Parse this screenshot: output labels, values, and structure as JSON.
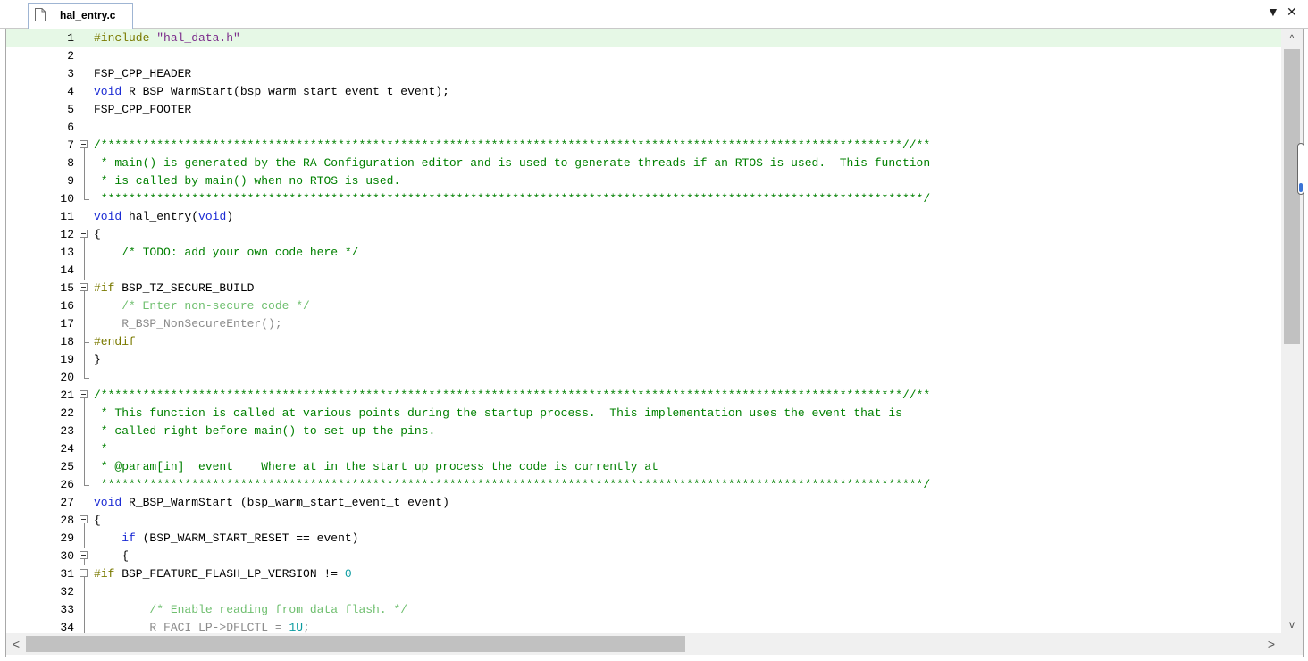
{
  "tab": {
    "filename": "hal_entry.c",
    "dropdown_icon": "▼",
    "close_icon": "✕"
  },
  "colors": {
    "keyword": "#1b2bd4",
    "comment": "#008000",
    "preprocessor": "#7a7a00",
    "string": "#7b2b8b",
    "number": "#0a9ba0",
    "inactive": "#8a8a8a",
    "inactive_comment": "#6fbf6f",
    "plain": "#000000",
    "current_line": "#e6f8e6"
  },
  "lines": [
    {
      "n": "1",
      "fold": "none",
      "hl": true,
      "tokens": [
        {
          "t": "#include ",
          "c": "preprocessor"
        },
        {
          "t": "\"hal_data.h\"",
          "c": "string"
        }
      ]
    },
    {
      "n": "2",
      "fold": "none",
      "tokens": []
    },
    {
      "n": "3",
      "fold": "none",
      "tokens": [
        {
          "t": "FSP_CPP_HEADER",
          "c": "plain"
        }
      ]
    },
    {
      "n": "4",
      "fold": "none",
      "tokens": [
        {
          "t": "void",
          "c": "keyword"
        },
        {
          "t": " R_BSP_WarmStart(bsp_warm_start_event_t event);",
          "c": "plain"
        }
      ]
    },
    {
      "n": "5",
      "fold": "none",
      "tokens": [
        {
          "t": "FSP_CPP_FOOTER",
          "c": "plain"
        }
      ]
    },
    {
      "n": "6",
      "fold": "none",
      "tokens": []
    },
    {
      "n": "7",
      "fold": "start",
      "tokens": [
        {
          "t": "/*******************************************************************************************************************//**",
          "c": "comment"
        }
      ]
    },
    {
      "n": "8",
      "fold": "line",
      "tokens": [
        {
          "t": " * main() is generated by the RA Configuration editor and is used to generate threads if an RTOS is used.  This function",
          "c": "comment"
        }
      ]
    },
    {
      "n": "9",
      "fold": "line",
      "tokens": [
        {
          "t": " * is called by main() when no RTOS is used.",
          "c": "comment"
        }
      ]
    },
    {
      "n": "10",
      "fold": "end",
      "tokens": [
        {
          "t": " **********************************************************************************************************************/",
          "c": "comment"
        }
      ]
    },
    {
      "n": "11",
      "fold": "none",
      "tokens": [
        {
          "t": "void",
          "c": "keyword"
        },
        {
          "t": " hal_entry(",
          "c": "plain"
        },
        {
          "t": "void",
          "c": "keyword"
        },
        {
          "t": ")",
          "c": "plain"
        }
      ]
    },
    {
      "n": "12",
      "fold": "start",
      "tokens": [
        {
          "t": "{",
          "c": "plain"
        }
      ]
    },
    {
      "n": "13",
      "fold": "line",
      "tokens": [
        {
          "t": "    /* TODO: add your own code here */",
          "c": "comment"
        }
      ]
    },
    {
      "n": "14",
      "fold": "line",
      "tokens": []
    },
    {
      "n": "15",
      "fold": "start",
      "tokens": [
        {
          "t": "#if",
          "c": "preprocessor"
        },
        {
          "t": " BSP_TZ_SECURE_BUILD",
          "c": "plain"
        }
      ]
    },
    {
      "n": "16",
      "fold": "line",
      "tokens": [
        {
          "t": "    /* Enter non-secure code */",
          "c": "inactive_comment"
        }
      ]
    },
    {
      "n": "17",
      "fold": "line",
      "tokens": [
        {
          "t": "    R_BSP_NonSecureEnter();",
          "c": "inactive"
        }
      ]
    },
    {
      "n": "18",
      "fold": "endsub",
      "tokens": [
        {
          "t": "#endif",
          "c": "preprocessor"
        }
      ]
    },
    {
      "n": "19",
      "fold": "line",
      "tokens": [
        {
          "t": "}",
          "c": "plain"
        }
      ]
    },
    {
      "n": "20",
      "fold": "end",
      "tokens": []
    },
    {
      "n": "21",
      "fold": "start",
      "tokens": [
        {
          "t": "/*******************************************************************************************************************//**",
          "c": "comment"
        }
      ]
    },
    {
      "n": "22",
      "fold": "line",
      "tokens": [
        {
          "t": " * This function is called at various points during the startup process.  This implementation uses the event that is",
          "c": "comment"
        }
      ]
    },
    {
      "n": "23",
      "fold": "line",
      "tokens": [
        {
          "t": " * called right before main() to set up the pins.",
          "c": "comment"
        }
      ]
    },
    {
      "n": "24",
      "fold": "line",
      "tokens": [
        {
          "t": " *",
          "c": "comment"
        }
      ]
    },
    {
      "n": "25",
      "fold": "line",
      "tokens": [
        {
          "t": " * @param[in]  event    Where at in the start up process the code is currently at",
          "c": "comment"
        }
      ]
    },
    {
      "n": "26",
      "fold": "end",
      "tokens": [
        {
          "t": " **********************************************************************************************************************/",
          "c": "comment"
        }
      ]
    },
    {
      "n": "27",
      "fold": "none",
      "tokens": [
        {
          "t": "void",
          "c": "keyword"
        },
        {
          "t": " R_BSP_WarmStart (bsp_warm_start_event_t event)",
          "c": "plain"
        }
      ]
    },
    {
      "n": "28",
      "fold": "start",
      "tokens": [
        {
          "t": "{",
          "c": "plain"
        }
      ]
    },
    {
      "n": "29",
      "fold": "line",
      "tokens": [
        {
          "t": "    ",
          "c": "plain"
        },
        {
          "t": "if",
          "c": "keyword"
        },
        {
          "t": " (BSP_WARM_START_RESET == event)",
          "c": "plain"
        }
      ]
    },
    {
      "n": "30",
      "fold": "start",
      "tokens": [
        {
          "t": "    {",
          "c": "plain"
        }
      ]
    },
    {
      "n": "31",
      "fold": "start",
      "tokens": [
        {
          "t": "#if",
          "c": "preprocessor"
        },
        {
          "t": " BSP_FEATURE_FLASH_LP_VERSION != ",
          "c": "plain"
        },
        {
          "t": "0",
          "c": "number"
        }
      ]
    },
    {
      "n": "32",
      "fold": "line",
      "tokens": []
    },
    {
      "n": "33",
      "fold": "line",
      "tokens": [
        {
          "t": "        /* Enable reading from data flash. */",
          "c": "inactive_comment"
        }
      ]
    },
    {
      "n": "34",
      "fold": "line",
      "tokens": [
        {
          "t": "        R_FACI_LP->DFLCTL = ",
          "c": "inactive"
        },
        {
          "t": "1U",
          "c": "number"
        },
        {
          "t": ";",
          "c": "inactive"
        }
      ]
    }
  ],
  "scrollbars": {
    "up_icon": "^",
    "down_icon": "v",
    "left_icon": "<",
    "right_icon": ">"
  }
}
